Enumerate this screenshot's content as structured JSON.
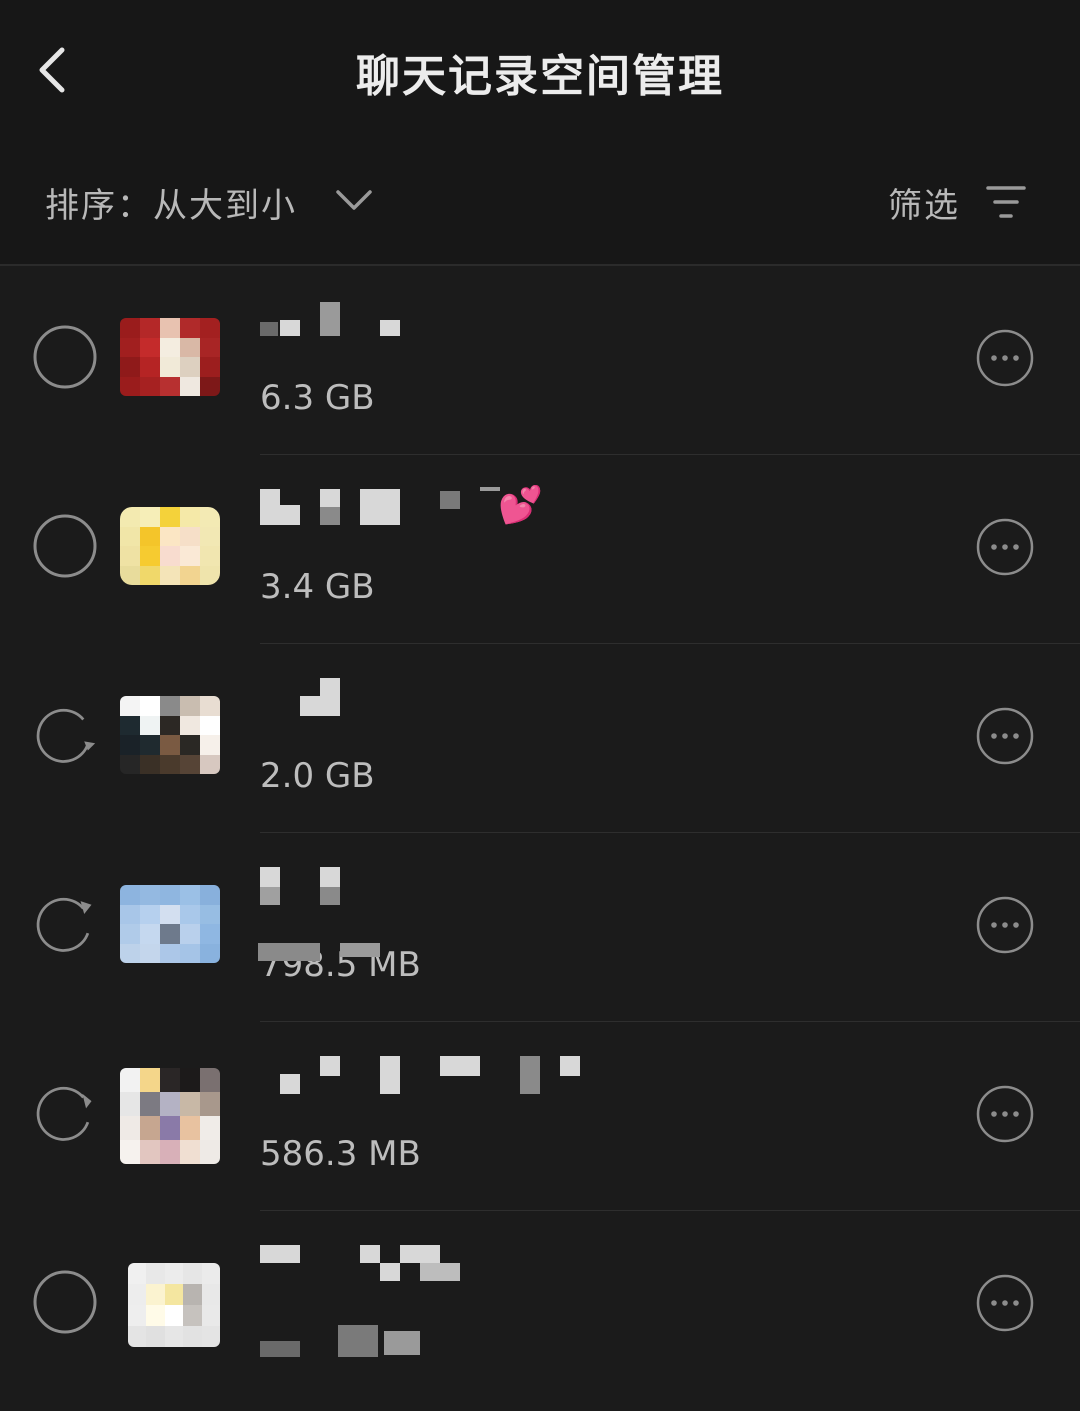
{
  "header": {
    "title": "聊天记录空间管理",
    "back_icon": "chevron-left-icon"
  },
  "sort": {
    "label": "排序：从大到小",
    "icon": "chevron-down-icon"
  },
  "filter": {
    "label": "筛选",
    "icon": "filter-icon"
  },
  "chats": [
    {
      "size": "6.3 GB",
      "state": "unchecked",
      "emoji": ""
    },
    {
      "size": "3.4 GB",
      "state": "unchecked",
      "emoji": "💕"
    },
    {
      "size": "2.0 GB",
      "state": "loading",
      "emoji": ""
    },
    {
      "size": "798.5 MB",
      "state": "loading",
      "emoji": ""
    },
    {
      "size": "586.3 MB",
      "state": "loading",
      "emoji": ""
    },
    {
      "size": "",
      "state": "unchecked",
      "emoji": ""
    }
  ],
  "colors": {
    "background": "#1b1b1b",
    "header": "#171717",
    "text": "#e6e6e6",
    "muted": "#bdbdbd",
    "icon_stroke": "#8c8c8c"
  }
}
